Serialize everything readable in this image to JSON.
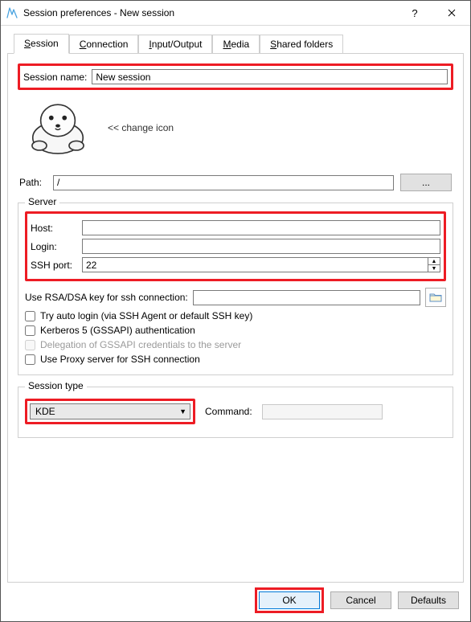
{
  "window": {
    "title": "Session preferences - New session"
  },
  "tabs": {
    "session": "Session",
    "connection": "Connection",
    "io": "Input/Output",
    "media": "Media",
    "shared": "Shared folders"
  },
  "session_name": {
    "label": "Session name:",
    "value": "New session"
  },
  "change_icon": "<< change icon",
  "path": {
    "label": "Path:",
    "value": "/",
    "browse": "..."
  },
  "server": {
    "legend": "Server",
    "host_label": "Host:",
    "host_value": "",
    "login_label": "Login:",
    "login_value": "",
    "sshport_label": "SSH port:",
    "sshport_value": "22",
    "rsa_label": "Use RSA/DSA key for ssh connection:",
    "rsa_value": "",
    "chk_autologin": "Try auto login (via SSH Agent or default SSH key)",
    "chk_kerberos": "Kerberos 5 (GSSAPI) authentication",
    "chk_delegation": "Delegation of GSSAPI credentials to the server",
    "chk_proxy": "Use Proxy server for SSH connection"
  },
  "session_type": {
    "legend": "Session type",
    "value": "KDE",
    "command_label": "Command:",
    "command_value": ""
  },
  "buttons": {
    "ok": "OK",
    "cancel": "Cancel",
    "defaults": "Defaults"
  }
}
